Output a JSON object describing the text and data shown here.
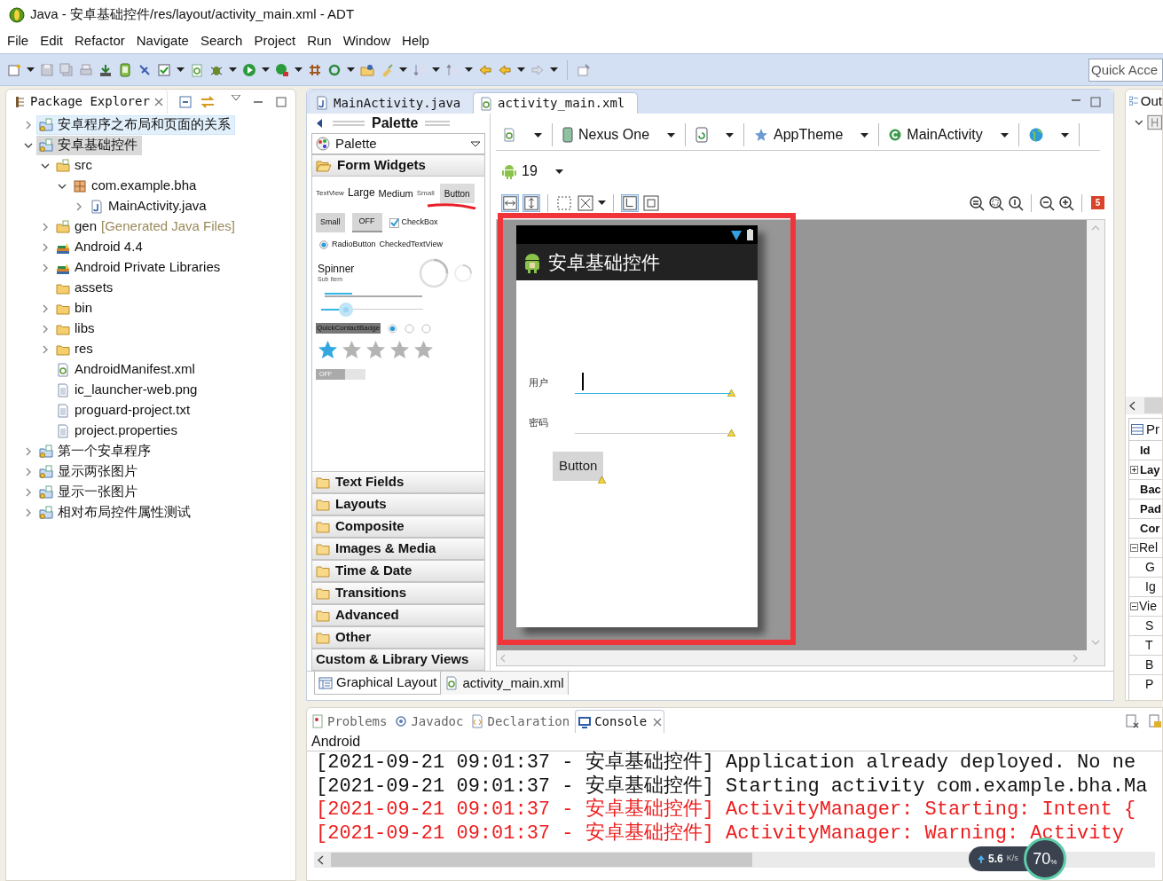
{
  "window": {
    "title": "Java - 安卓基础控件/res/layout/activity_main.xml - ADT"
  },
  "menu": [
    "File",
    "Edit",
    "Refactor",
    "Navigate",
    "Search",
    "Project",
    "Run",
    "Window",
    "Help"
  ],
  "toolbar": {
    "quick_access": {
      "placeholder": "Quick Acce"
    }
  },
  "package_explorer": {
    "title": "Package Explorer",
    "tree": [
      {
        "label": "安卓程序之布局和页面的关系",
        "kind": "project",
        "expanded": false,
        "selected": false,
        "hovered": true
      },
      {
        "label": "安卓基础控件",
        "kind": "project",
        "expanded": true,
        "selected": true,
        "hovered": false,
        "children": [
          {
            "label": "src",
            "kind": "source",
            "expanded": true,
            "selected": false,
            "hovered": false,
            "children": [
              {
                "label": "com.example.bha",
                "kind": "package",
                "expanded": true,
                "selected": false,
                "hovered": false,
                "children": [
                  {
                    "label": "MainActivity.java",
                    "kind": "java",
                    "expanded": false,
                    "selected": false,
                    "hovered": false
                  }
                ]
              }
            ]
          },
          {
            "label": "gen",
            "note": "[Generated Java Files]",
            "kind": "source",
            "expanded": false,
            "selected": false,
            "hovered": false
          },
          {
            "label": "Android 4.4",
            "kind": "library",
            "expanded": false,
            "selected": false,
            "hovered": false
          },
          {
            "label": "Android Private Libraries",
            "kind": "library",
            "expanded": false,
            "selected": false,
            "hovered": false
          },
          {
            "label": "assets",
            "kind": "folder",
            "selected": false,
            "hovered": false
          },
          {
            "label": "bin",
            "kind": "folder",
            "expanded": false,
            "selected": false,
            "hovered": false
          },
          {
            "label": "libs",
            "kind": "folder",
            "expanded": false,
            "selected": false,
            "hovered": false
          },
          {
            "label": "res",
            "kind": "folder",
            "expanded": false,
            "selected": false,
            "hovered": false
          },
          {
            "label": "AndroidManifest.xml",
            "kind": "xml",
            "selected": false,
            "hovered": false
          },
          {
            "label": "ic_launcher-web.png",
            "kind": "file",
            "selected": false,
            "hovered": false
          },
          {
            "label": "proguard-project.txt",
            "kind": "file",
            "selected": false,
            "hovered": false
          },
          {
            "label": "project.properties",
            "kind": "file",
            "selected": false,
            "hovered": false
          }
        ]
      },
      {
        "label": "第一个安卓程序",
        "kind": "project",
        "expanded": false,
        "selected": false,
        "hovered": false
      },
      {
        "label": "显示两张图片",
        "kind": "project",
        "expanded": false,
        "selected": false,
        "hovered": false
      },
      {
        "label": "显示一张图片",
        "kind": "project",
        "expanded": false,
        "selected": false,
        "hovered": false
      },
      {
        "label": "相对布局控件属性测试",
        "kind": "project",
        "expanded": false,
        "selected": false,
        "hovered": false
      }
    ]
  },
  "editor": {
    "tabs": [
      {
        "label": "MainActivity.java",
        "kind": "java",
        "selected": false
      },
      {
        "label": "activity_main.xml",
        "kind": "xml",
        "selected": true
      }
    ],
    "palette": {
      "header": "Palette",
      "dropdown": "Palette",
      "widgets": {
        "textview": "TextView",
        "large": "Large",
        "medium": "Medium",
        "small": "Small",
        "button": "Button",
        "small_button": "Small",
        "toggle": "OFF",
        "checkbox": {
          "label": "CheckBox",
          "checked": true
        },
        "radio": {
          "label": "RadioButton",
          "checked": true
        },
        "checked_text_view": "CheckedTextView",
        "spinner": {
          "title": "Spinner",
          "subtitle": "Sub Item"
        },
        "progress": {
          "level": 0.28
        },
        "seekbar": {
          "level": 0.24
        },
        "quick_contact_badge": "QuickContactBadge",
        "radio_group": [
          {
            "selected": true
          },
          {
            "selected": false
          },
          {
            "selected": false
          }
        ],
        "rating": {
          "stars": 1
        },
        "switch": {
          "label": "OFF",
          "on": false
        }
      },
      "sections": [
        {
          "label": "Form Widgets",
          "kind": "folder",
          "expanded": true
        },
        {
          "label": "Text Fields",
          "kind": "folder",
          "expanded": false
        },
        {
          "label": "Layouts",
          "kind": "folder",
          "expanded": false
        },
        {
          "label": "Composite",
          "kind": "folder",
          "expanded": false
        },
        {
          "label": "Images & Media",
          "kind": "folder",
          "expanded": false
        },
        {
          "label": "Time & Date",
          "kind": "folder",
          "expanded": false
        },
        {
          "label": "Transitions",
          "kind": "folder",
          "expanded": false
        },
        {
          "label": "Advanced",
          "kind": "folder",
          "expanded": false
        },
        {
          "label": "Other",
          "kind": "folder",
          "expanded": false
        },
        {
          "label": "Custom & Library Views",
          "kind": "plain",
          "expanded": false
        }
      ]
    },
    "layout_toolbar": {
      "device": "Nexus One",
      "theme": "AppTheme",
      "activity": "MainActivity",
      "api_level": "19",
      "error_count": "5"
    },
    "preview": {
      "app_title": "安卓基础控件",
      "fields": [
        {
          "label": "用户",
          "focused": true
        },
        {
          "label": "密码",
          "focused": false
        }
      ],
      "button": "Button"
    },
    "bottom_tabs": [
      {
        "label": "Graphical Layout",
        "kind": "design",
        "selected": true
      },
      {
        "label": "activity_main.xml",
        "kind": "xml",
        "selected": false
      }
    ]
  },
  "outline": {
    "title": "Out"
  },
  "properties": {
    "title": "Pr",
    "rows": [
      {
        "label": "Id",
        "kind": "property"
      },
      {
        "label": "Lay",
        "kind": "property",
        "expanded": false
      },
      {
        "label": "Bac",
        "kind": "property"
      },
      {
        "label": "Pad",
        "kind": "property"
      },
      {
        "label": "Cor",
        "kind": "property"
      },
      {
        "label": "Rel",
        "kind": "category",
        "expanded": true,
        "children": [
          {
            "label": "G"
          },
          {
            "label": "Ig"
          }
        ]
      },
      {
        "label": "Vie",
        "kind": "category",
        "expanded": true,
        "children": [
          {
            "label": "S"
          },
          {
            "label": "T"
          },
          {
            "label": "B"
          },
          {
            "label": "P"
          }
        ]
      }
    ]
  },
  "console": {
    "tabs": [
      {
        "label": "Problems",
        "kind": "problems",
        "selected": false
      },
      {
        "label": "Javadoc",
        "kind": "javadoc",
        "selected": false
      },
      {
        "label": "Declaration",
        "kind": "declaration",
        "selected": false
      },
      {
        "label": "Console",
        "kind": "console",
        "selected": true
      }
    ],
    "source": "Android",
    "lines": [
      {
        "text": "[2021-09-21 09:01:37 - 安卓基础控件] Application already deployed. No ne",
        "kind": "info"
      },
      {
        "text": "[2021-09-21 09:01:37 - 安卓基础控件] Starting activity com.example.bha.Ma",
        "kind": "info"
      },
      {
        "text": "[2021-09-21 09:01:37 - 安卓基础控件] ActivityManager: Starting: Intent {",
        "kind": "error"
      },
      {
        "text": "[2021-09-21 09:01:37 - 安卓基础控件] ActivityManager: Warning: Activity",
        "kind": "error"
      }
    ]
  },
  "net_monitor": {
    "speed": "5.6",
    "unit": "K/s",
    "percent": "70",
    "percent_unit": "%"
  }
}
